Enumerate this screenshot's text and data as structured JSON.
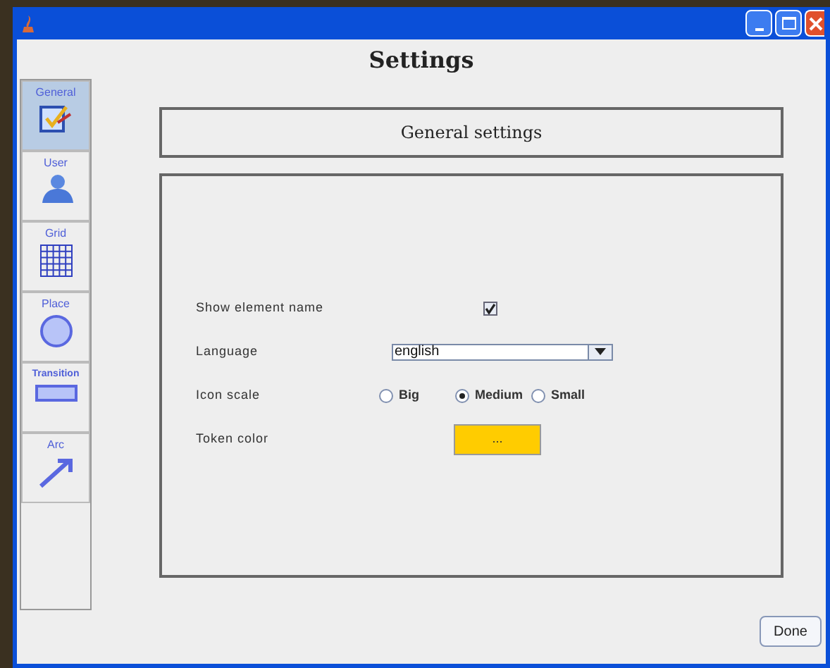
{
  "window": {
    "title": "Settings"
  },
  "sidebar": {
    "items": [
      {
        "label": "General",
        "kind": "general",
        "selected": true
      },
      {
        "label": "User",
        "kind": "user",
        "selected": false
      },
      {
        "label": "Grid",
        "kind": "grid",
        "selected": false
      },
      {
        "label": "Place",
        "kind": "place",
        "selected": false
      },
      {
        "label": "Transition",
        "kind": "transition",
        "selected": false
      },
      {
        "label": "Arc",
        "kind": "arc",
        "selected": false
      }
    ]
  },
  "header": "General settings",
  "settings": [
    {
      "kind": "checkbox",
      "label": "Show element name",
      "checked": true
    },
    {
      "kind": "dropdown",
      "label": "Language",
      "value": "english"
    },
    {
      "kind": "radio",
      "label": "Icon scale",
      "options": [
        {
          "label": "Big",
          "selected": false
        },
        {
          "label": "Medium",
          "selected": true
        },
        {
          "label": "Small",
          "selected": false
        }
      ]
    },
    {
      "kind": "color",
      "label": "Token color",
      "color": "#ffcc00",
      "button": "..."
    }
  ],
  "buttons": [
    "Done"
  ]
}
